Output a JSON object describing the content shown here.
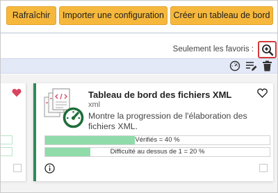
{
  "toolbar": {
    "refresh_label": "Rafraîchir",
    "import_label": "Importer une configuration",
    "create_label": "Créer un tableau de bord",
    "button_color": "#f6b83c"
  },
  "favorites": {
    "label": "Seulement les favoris :",
    "zoom_icon": "zoom-in-icon"
  },
  "actions": {
    "icons": [
      "speedometer-icon",
      "edit-list-icon",
      "trash-icon"
    ]
  },
  "card": {
    "title": "Tableau de bord des fichiers XML",
    "subtitle": "xml",
    "description": "Montre la progression de l'élaboration des fichiers XML.",
    "favorite_icon": "heart-outline-icon",
    "icon": "xml-documents-icon",
    "accent_color": "#2e8b57",
    "indicators": [
      {
        "label": "Vérifiés = 40 %",
        "percent": 40
      },
      {
        "label": "Difficulté au dessus de 1 = 20 %",
        "percent": 20
      }
    ]
  },
  "left_card": {
    "favorite_icon": "heart-filled-icon",
    "favorite_color": "#d9455f"
  }
}
